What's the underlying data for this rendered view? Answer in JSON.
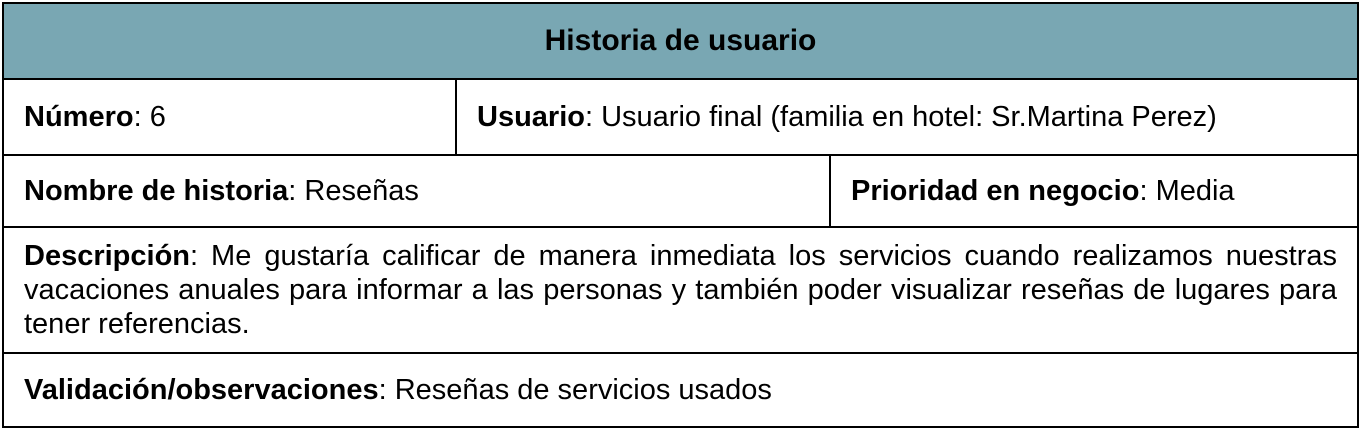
{
  "title": "Historia de usuario",
  "numero": {
    "label": "Número",
    "value": "6"
  },
  "usuario": {
    "label": "Usuario",
    "value": "Usuario final (familia en hotel: Sr.Martina Perez)"
  },
  "nombre_historia": {
    "label": "Nombre de historia",
    "value": "Reseñas"
  },
  "prioridad": {
    "label": "Prioridad en negocio",
    "value": "Media"
  },
  "descripcion": {
    "label": "Descripción",
    "value": "Me gustaría calificar de manera inmediata los servicios cuando realizamos nuestras vacaciones anuales para informar a las personas y también poder visualizar reseñas de lugares para tener referencias."
  },
  "validacion": {
    "label": "Validación/observaciones",
    "value": "Reseñas de servicios usados"
  },
  "colors": {
    "header_bg": "#79a7b3",
    "border": "#000000"
  }
}
